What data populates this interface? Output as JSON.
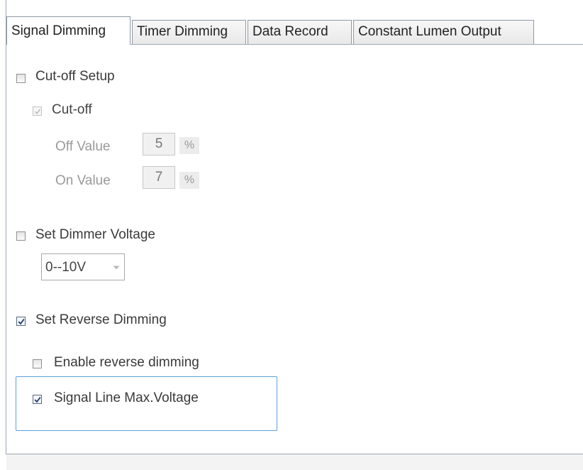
{
  "tabs": [
    {
      "label": "Signal Dimming",
      "active": true
    },
    {
      "label": "Timer Dimming",
      "active": false
    },
    {
      "label": "Data Record",
      "active": false
    },
    {
      "label": "Constant Lumen Output",
      "active": false
    }
  ],
  "cutoff_setup": {
    "label": "Cut-off Setup",
    "checked": false,
    "cutoff": {
      "label": "Cut-off",
      "checked": true,
      "disabled": true
    },
    "off_value": {
      "label": "Off Value",
      "value": "5",
      "unit": "%"
    },
    "on_value": {
      "label": "On Value",
      "value": "7",
      "unit": "%"
    }
  },
  "dimmer_voltage": {
    "label": "Set Dimmer Voltage",
    "checked": false,
    "selected": "0--10V",
    "icon": "chevron-down-icon"
  },
  "reverse_dimming": {
    "label": "Set Reverse Dimming",
    "checked": true,
    "enable": {
      "label": "Enable reverse dimming",
      "checked": false
    },
    "signal_line": {
      "label": "Signal Line Max.Voltage",
      "checked": true
    }
  },
  "colors": {
    "focus_border": "#5aa0dc",
    "check_mark": "#1f3a6b",
    "disabled_text": "#9a9a9a",
    "frame_border": "#9aa6b4"
  }
}
